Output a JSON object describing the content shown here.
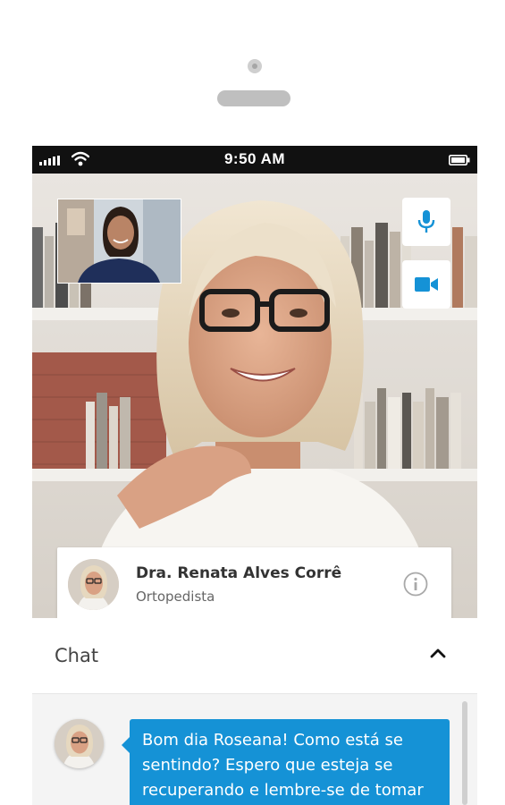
{
  "status_bar": {
    "time": "9:50 AM"
  },
  "call": {
    "doctor_name": "Dra. Renata Alves Corrê",
    "doctor_specialty": "Ortopedista"
  },
  "chat": {
    "title": "Chat",
    "messages": [
      {
        "text": "Bom dia Roseana! Como está se sentindo? Espero que esteja se recuperando e lembre-se de tomar"
      }
    ]
  },
  "colors": {
    "accent": "#1592d6",
    "status_bar": "#111111",
    "bubble_text": "#ffffff"
  },
  "icons": {
    "microphone": "microphone-icon",
    "camera": "video-camera-icon",
    "info": "info-icon",
    "collapse": "chevron-up-icon",
    "signal": "signal-icon",
    "wifi": "wifi-icon",
    "battery": "battery-icon"
  }
}
